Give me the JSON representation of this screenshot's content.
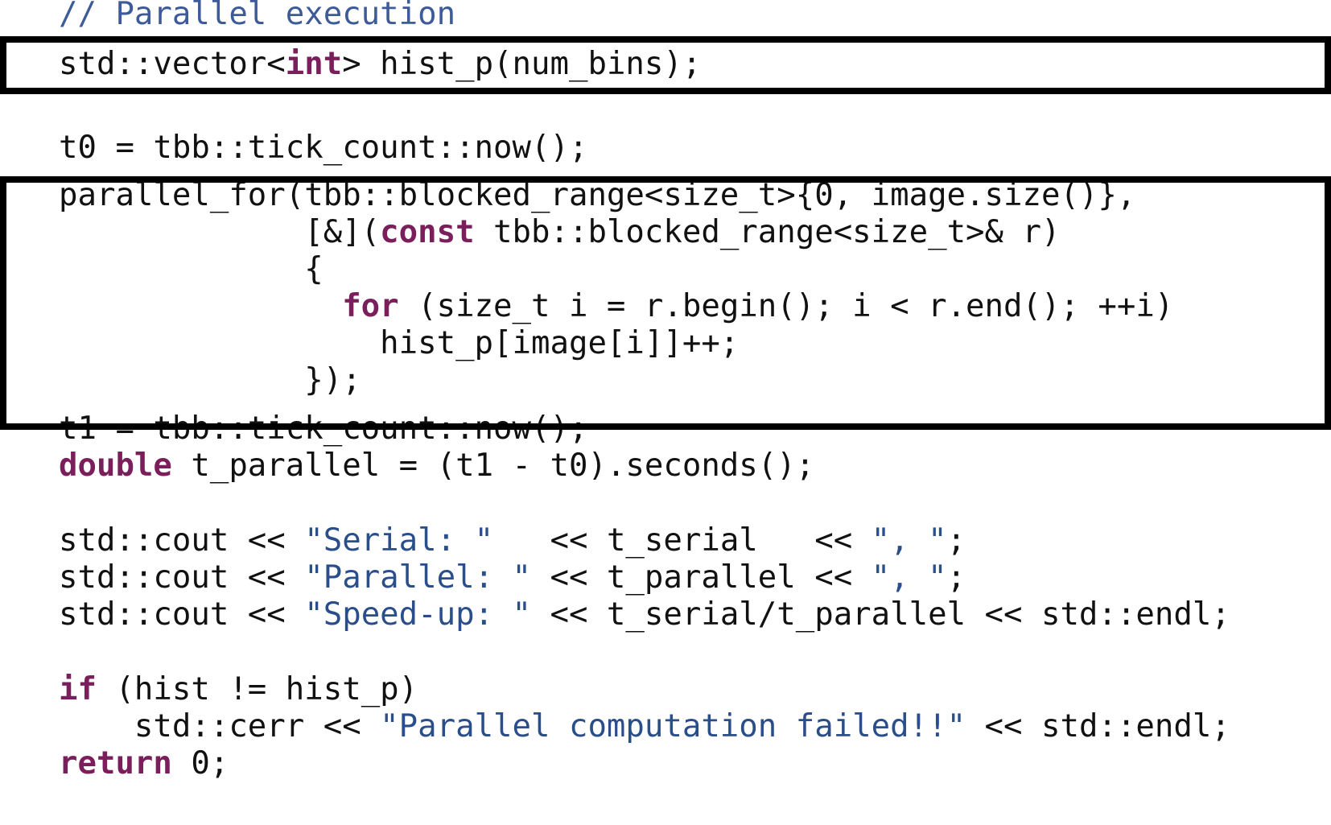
{
  "code": {
    "lines": [
      [
        {
          "t": "// Parallel execution",
          "k": "comment"
        }
      ],
      [
        {
          "t": "std::vector<",
          "k": "text"
        },
        {
          "t": "int",
          "k": "kw"
        },
        {
          "t": "> hist_p(num_bins);",
          "k": "text"
        }
      ],
      [
        {
          "t": "t0 = tbb::tick_count::now();",
          "k": "text"
        }
      ],
      [
        {
          "t": "parallel_for(tbb::blocked_range<size_t>{0, image.size()},",
          "k": "text"
        }
      ],
      [
        {
          "t": "             [&](",
          "k": "text"
        },
        {
          "t": "const",
          "k": "kw"
        },
        {
          "t": " tbb::blocked_range<size_t>& r)",
          "k": "text"
        }
      ],
      [
        {
          "t": "             {",
          "k": "text"
        }
      ],
      [
        {
          "t": "               ",
          "k": "text"
        },
        {
          "t": "for",
          "k": "kw"
        },
        {
          "t": " (size_t i = r.begin(); i < r.end(); ++i)",
          "k": "text"
        }
      ],
      [
        {
          "t": "                 hist_p[image[i]]++;",
          "k": "text"
        }
      ],
      [
        {
          "t": "             });",
          "k": "text"
        }
      ],
      [
        {
          "t": "t1 = tbb::tick_count::now();",
          "k": "text"
        }
      ],
      [
        {
          "t": "double",
          "k": "kw"
        },
        {
          "t": " t_parallel = (t1 - t0).seconds();",
          "k": "text"
        }
      ],
      [
        {
          "t": "std::cout << ",
          "k": "text"
        },
        {
          "t": "\"Serial: \"",
          "k": "str"
        },
        {
          "t": "   << t_serial   << ",
          "k": "text"
        },
        {
          "t": "\", \"",
          "k": "str"
        },
        {
          "t": ";",
          "k": "text"
        }
      ],
      [
        {
          "t": "std::cout << ",
          "k": "text"
        },
        {
          "t": "\"Parallel: \"",
          "k": "str"
        },
        {
          "t": " << t_parallel << ",
          "k": "text"
        },
        {
          "t": "\", \"",
          "k": "str"
        },
        {
          "t": ";",
          "k": "text"
        }
      ],
      [
        {
          "t": "std::cout << ",
          "k": "text"
        },
        {
          "t": "\"Speed-up: \"",
          "k": "str"
        },
        {
          "t": " << t_serial/t_parallel << std::endl;",
          "k": "text"
        }
      ],
      [
        {
          "t": "if",
          "k": "kw"
        },
        {
          "t": " (hist != hist_p)",
          "k": "text"
        }
      ],
      [
        {
          "t": "    std::cerr << ",
          "k": "text"
        },
        {
          "t": "\"Parallel computation failed!!\"",
          "k": "str"
        },
        {
          "t": " << std::endl;",
          "k": "text"
        }
      ],
      [
        {
          "t": "return",
          "k": "kw"
        },
        {
          "t": " 0;",
          "k": "text"
        }
      ]
    ]
  },
  "colors": {
    "keyword": "#7a1f5c",
    "string": "#2a4e8a",
    "comment": "#3d5a99",
    "text": "#111111",
    "box_border": "#000000"
  }
}
